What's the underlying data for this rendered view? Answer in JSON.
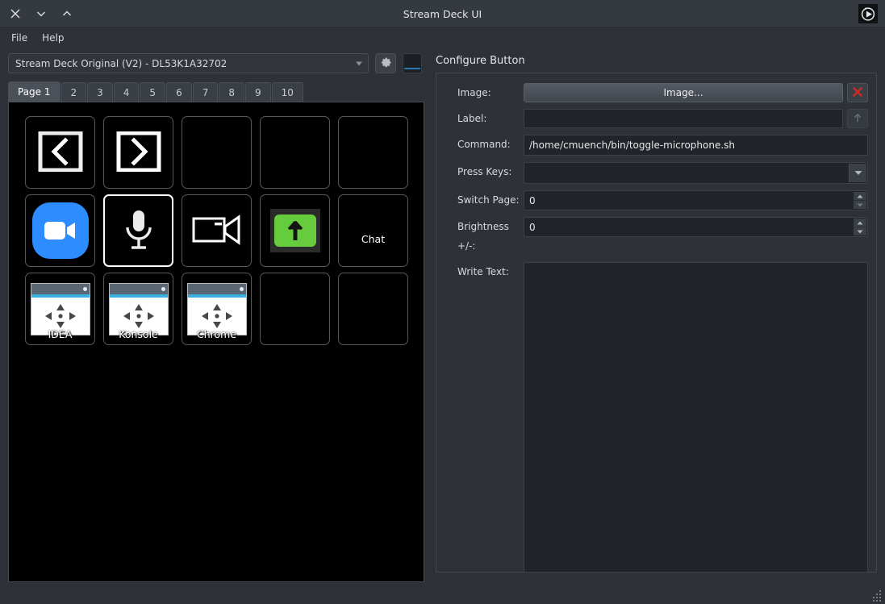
{
  "window": {
    "title": "Stream Deck UI",
    "controls": [
      {
        "name": "close",
        "icon": "close-icon"
      },
      {
        "name": "minimize",
        "icon": "chevron-down-icon"
      },
      {
        "name": "maximize",
        "icon": "chevron-up-icon"
      }
    ],
    "app_icon": "play-circle-icon"
  },
  "menubar": {
    "items": [
      {
        "label": "File"
      },
      {
        "label": "Help"
      }
    ]
  },
  "device": {
    "selected": "Stream Deck Original (V2) - DL53K1A32702",
    "settings_icon": "gear-icon",
    "dimmer_icon": "brightness-swatch",
    "accent": "#2a7ab0"
  },
  "pages": {
    "tabs": [
      {
        "label": "Page 1",
        "active": true
      },
      {
        "label": "2",
        "active": false
      },
      {
        "label": "3",
        "active": false
      },
      {
        "label": "4",
        "active": false
      },
      {
        "label": "5",
        "active": false
      },
      {
        "label": "6",
        "active": false
      },
      {
        "label": "7",
        "active": false
      },
      {
        "label": "8",
        "active": false
      },
      {
        "label": "9",
        "active": false
      },
      {
        "label": "10",
        "active": false
      }
    ]
  },
  "deck": {
    "rows": 3,
    "cols": 5,
    "keys": [
      {
        "index": 0,
        "icon": "prev-page-icon",
        "label": "",
        "selected": false
      },
      {
        "index": 1,
        "icon": "next-page-icon",
        "label": "",
        "selected": false
      },
      {
        "index": 2,
        "icon": "",
        "label": "",
        "selected": false
      },
      {
        "index": 3,
        "icon": "",
        "label": "",
        "selected": false
      },
      {
        "index": 4,
        "icon": "",
        "label": "",
        "selected": false
      },
      {
        "index": 5,
        "icon": "zoom-app-icon",
        "label": "",
        "selected": false
      },
      {
        "index": 6,
        "icon": "microphone-icon",
        "label": "",
        "selected": true
      },
      {
        "index": 7,
        "icon": "video-camera-icon",
        "label": "",
        "selected": false
      },
      {
        "index": 8,
        "icon": "green-arrow-up-icon",
        "label": "",
        "selected": false
      },
      {
        "index": 9,
        "icon": "",
        "label": "Chat",
        "selected": false
      },
      {
        "index": 10,
        "icon": "window-move-icon",
        "label": "IDEA",
        "selected": false
      },
      {
        "index": 11,
        "icon": "window-move-icon",
        "label": "Konsole",
        "selected": false
      },
      {
        "index": 12,
        "icon": "window-move-icon",
        "label": "Chrome",
        "selected": false
      },
      {
        "index": 13,
        "icon": "",
        "label": "",
        "selected": false
      },
      {
        "index": 14,
        "icon": "",
        "label": "",
        "selected": false
      }
    ]
  },
  "configure": {
    "title": "Configure Button",
    "image": {
      "label": "Image:",
      "button_label": "Image...",
      "remove_icon": "red-x-icon"
    },
    "label_field": {
      "label": "Label:",
      "value": "",
      "placeholder": "",
      "align_icon": "arrow-up-icon"
    },
    "command": {
      "label": "Command:",
      "value": "/home/cmuench/bin/toggle-microphone.sh",
      "placeholder": ""
    },
    "press_keys": {
      "label": "Press Keys:",
      "value": "",
      "placeholder": "",
      "dropdown_icon": "chevron-down-icon"
    },
    "switch_page": {
      "label": "Switch Page:",
      "value": "0"
    },
    "brightness": {
      "label": "Brightness +/-:",
      "value": "0"
    },
    "write_text": {
      "label": "Write Text:",
      "value": "",
      "placeholder": ""
    }
  }
}
